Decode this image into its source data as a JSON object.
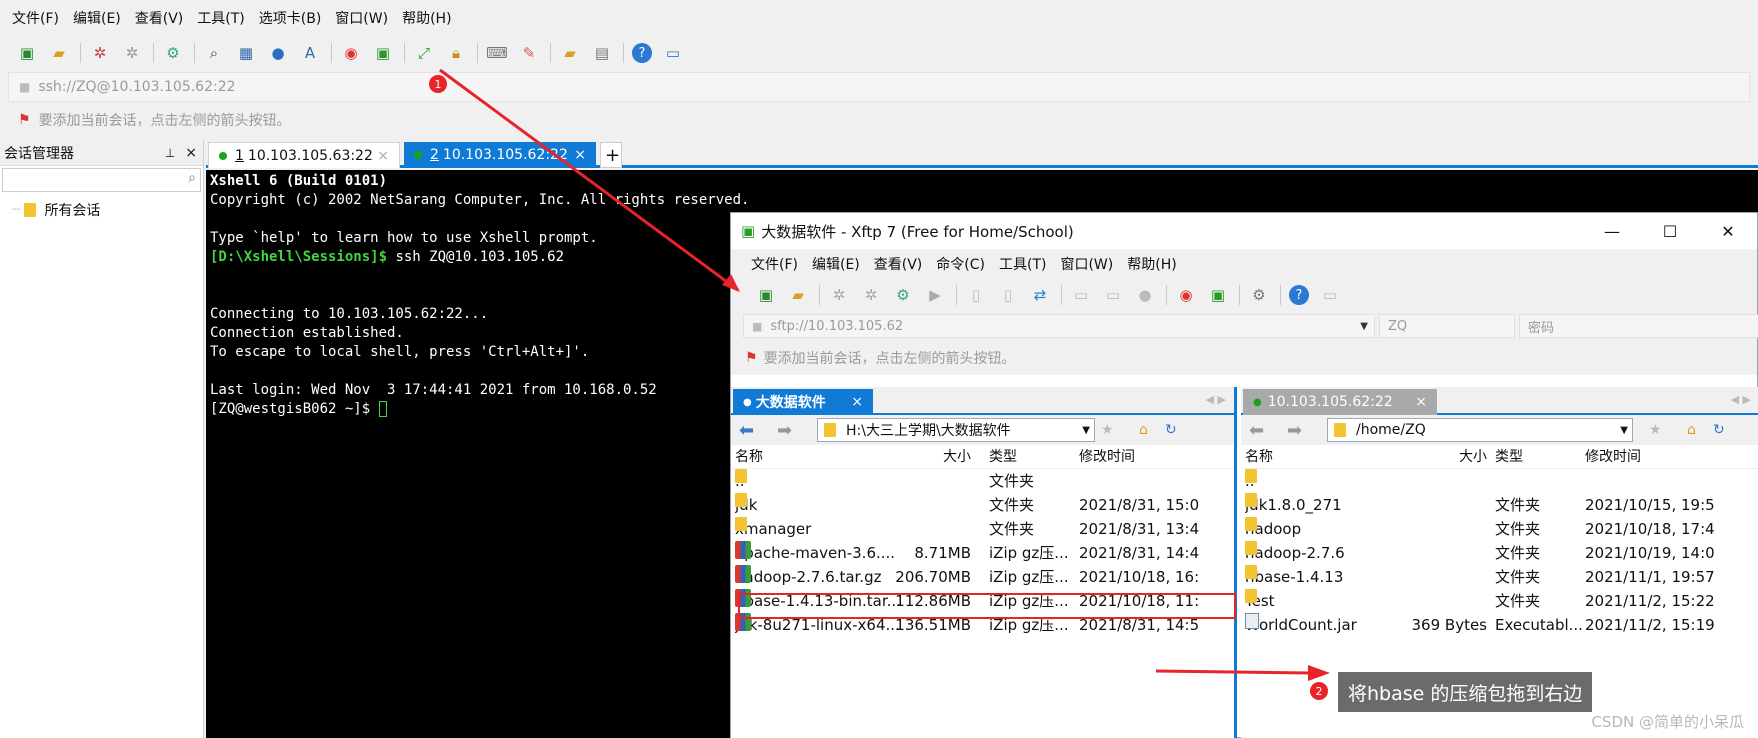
{
  "xshell": {
    "menu": [
      "文件(F)",
      "编辑(E)",
      "查看(V)",
      "工具(T)",
      "选项卡(B)",
      "窗口(W)",
      "帮助(H)"
    ],
    "address": "ssh://ZQ@10.103.105.62:22",
    "hint": "要添加当前会话，点击左侧的箭头按钮。",
    "session_manager": {
      "title": "会话管理器",
      "pin": "⊥",
      "close": "×",
      "tree_item": "所有会话"
    },
    "tabs": [
      {
        "num": "1",
        "label": "10.103.105.63:22",
        "active": false
      },
      {
        "num": "2",
        "label": "10.103.105.62:22",
        "active": true
      }
    ],
    "add_tab": "+",
    "terminal": {
      "line1": "Xshell 6 (Build 0101)",
      "line2": "Copyright (c) 2002 NetSarang Computer, Inc. All rights reserved.",
      "line3": "Type `help' to learn how to use Xshell prompt.",
      "prompt_local": "[D:\\Xshell\\Sessions]$",
      "cmd": " ssh ZQ@10.103.105.62",
      "line5": "Connecting to 10.103.105.62:22...",
      "line6": "Connection established.",
      "line7": "To escape to local shell, press 'Ctrl+Alt+]'.",
      "line8": "Last login: Wed Nov  3 17:44:41 2021 from 10.168.0.52",
      "prompt_remote": "[ZQ@westgisB062 ~]$ "
    }
  },
  "xftp": {
    "title": "大数据软件 - Xftp 7 (Free for Home/School)",
    "menu": [
      "文件(F)",
      "编辑(E)",
      "查看(V)",
      "命令(C)",
      "工具(T)",
      "窗口(W)",
      "帮助(H)"
    ],
    "address": "sftp://10.103.105.62",
    "user_placeholder": "ZQ",
    "password_placeholder": "密码",
    "hint": "要添加当前会话，点击左侧的箭头按钮。",
    "left": {
      "tab": "大数据软件",
      "path": "H:\\大三上学期\\大数据软件",
      "columns": [
        "名称",
        "大小",
        "类型",
        "修改时间"
      ],
      "rows": [
        {
          "icon": "folder",
          "name": "..",
          "size": "",
          "type": "文件夹",
          "date": ""
        },
        {
          "icon": "folder",
          "name": "jdk",
          "size": "",
          "type": "文件夹",
          "date": "2021/8/31, 15:0"
        },
        {
          "icon": "folder",
          "name": "xmanager",
          "size": "",
          "type": "文件夹",
          "date": "2021/8/31, 13:4"
        },
        {
          "icon": "zip",
          "name": "apache-maven-3.6....",
          "size": "8.71MB",
          "type": "iZip gz压...",
          "date": "2021/8/31, 14:4"
        },
        {
          "icon": "zip",
          "name": "hadoop-2.7.6.tar.gz",
          "size": "206.70MB",
          "type": "iZip gz压...",
          "date": "2021/10/18, 16:"
        },
        {
          "icon": "zip",
          "name": "hbase-1.4.13-bin.tar...",
          "size": "112.86MB",
          "type": "iZip gz压...",
          "date": "2021/10/18, 11:"
        },
        {
          "icon": "zip",
          "name": "jdk-8u271-linux-x64...",
          "size": "136.51MB",
          "type": "iZip gz压...",
          "date": "2021/8/31, 14:5"
        }
      ]
    },
    "right": {
      "tab": "10.103.105.62:22",
      "path": "/home/ZQ",
      "columns": [
        "名称",
        "大小",
        "类型",
        "修改时间"
      ],
      "rows": [
        {
          "icon": "folder",
          "name": "..",
          "size": "",
          "type": "",
          "date": ""
        },
        {
          "icon": "folder",
          "name": "jdk1.8.0_271",
          "size": "",
          "type": "文件夹",
          "date": "2021/10/15, 19:5"
        },
        {
          "icon": "folder",
          "name": "hadoop",
          "size": "",
          "type": "文件夹",
          "date": "2021/10/18, 17:4"
        },
        {
          "icon": "folder",
          "name": "hadoop-2.7.6",
          "size": "",
          "type": "文件夹",
          "date": "2021/10/19, 14:0"
        },
        {
          "icon": "folder",
          "name": "hbase-1.4.13",
          "size": "",
          "type": "文件夹",
          "date": "2021/11/1, 19:57"
        },
        {
          "icon": "folder",
          "name": "Test",
          "size": "",
          "type": "文件夹",
          "date": "2021/11/2, 15:22"
        },
        {
          "icon": "jar",
          "name": "WorldCount.jar",
          "size": "369 Bytes",
          "type": "Executabl...",
          "date": "2021/11/2, 15:19"
        }
      ]
    }
  },
  "annotations": {
    "badge1": "1",
    "badge2": "2",
    "callout": "将hbase 的压缩包拖到右边",
    "watermark": "CSDN @简单的小呆瓜",
    "accent": "#e8232a"
  }
}
